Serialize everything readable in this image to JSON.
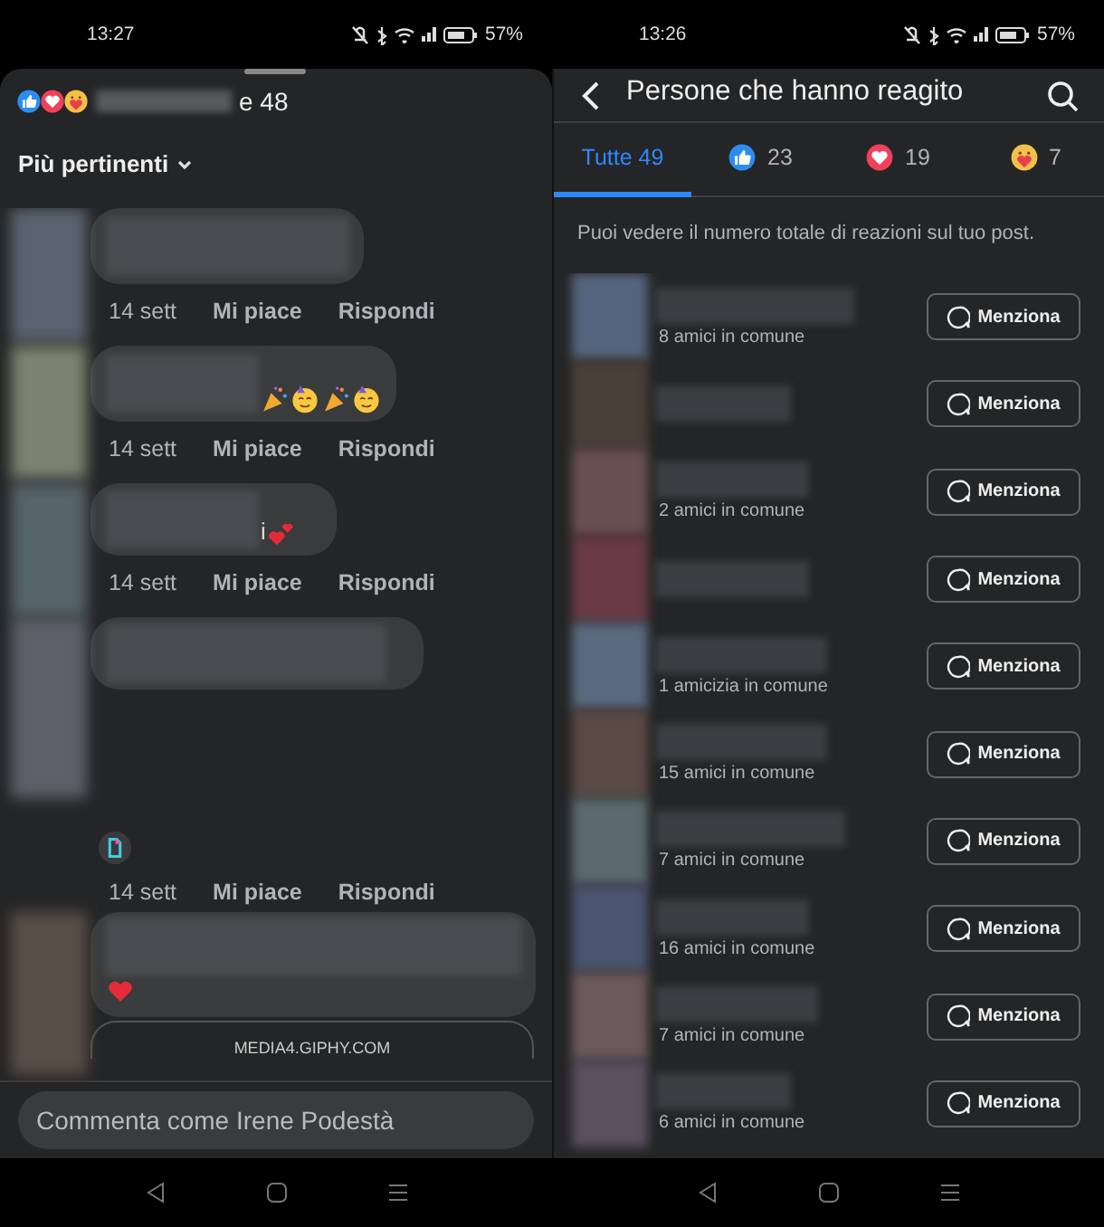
{
  "left": {
    "status_bar": {
      "time": "13:27",
      "battery": "57%"
    },
    "reactions_summary": {
      "icons": [
        {
          "kind": "like"
        },
        {
          "kind": "love"
        },
        {
          "kind": "care"
        }
      ],
      "others": "e 48"
    },
    "sort": {
      "label": "Più pertinenti"
    },
    "comments": [
      {
        "meta": {
          "time": "14 sett",
          "like": "Mi piace",
          "reply": "Rispondi"
        }
      },
      {
        "emoji": [
          {
            "kind": "party"
          },
          {
            "kind": "face"
          },
          {
            "kind": "party"
          },
          {
            "kind": "face"
          }
        ],
        "meta": {
          "time": "14 sett",
          "like": "Mi piace",
          "reply": "Rispondi"
        }
      },
      {
        "suffix": "i",
        "emoji": [
          {
            "kind": "hearts"
          }
        ],
        "meta": {
          "time": "14 sett",
          "like": "Mi piace",
          "reply": "Rispondi"
        }
      },
      {
        "reply_gif": true,
        "meta": {
          "time": "14 sett",
          "like": "Mi piace",
          "reply": "Rispondi"
        }
      },
      {
        "emoji": [
          {
            "kind": "heart"
          }
        ],
        "link": "MEDIA4.GIPHY.COM"
      }
    ],
    "comment_field": {
      "placeholder": "Commenta come Irene Podestà"
    }
  },
  "right": {
    "status_bar": {
      "time": "13:26",
      "battery": "57%"
    },
    "title": "Persone che hanno reagito",
    "tabs": [
      {
        "kind": "all",
        "label": "Tutte 49",
        "selected": true
      },
      {
        "kind": "like",
        "label": "23",
        "selected": false
      },
      {
        "kind": "love",
        "label": "19",
        "selected": false
      },
      {
        "kind": "care",
        "label": "7",
        "selected": false
      }
    ],
    "info": "Puoi vedere il numero totale di reazioni sul tuo post.",
    "people": [
      {
        "mutual": "8 amici in comune",
        "button": "Menziona"
      },
      {
        "button": "Menziona"
      },
      {
        "mutual": "2 amici in comune",
        "button": "Menziona"
      },
      {
        "button": "Menziona"
      },
      {
        "mutual": "1 amicizia in comune",
        "button": "Menziona"
      },
      {
        "mutual": "15 amici in comune",
        "button": "Menziona"
      },
      {
        "mutual": "7 amici in comune",
        "button": "Menziona"
      },
      {
        "mutual": "16 amici in comune",
        "button": "Menziona"
      },
      {
        "mutual": "7 amici in comune",
        "button": "Menziona"
      },
      {
        "mutual": "6 amici in comune",
        "button": "Menziona"
      }
    ]
  }
}
